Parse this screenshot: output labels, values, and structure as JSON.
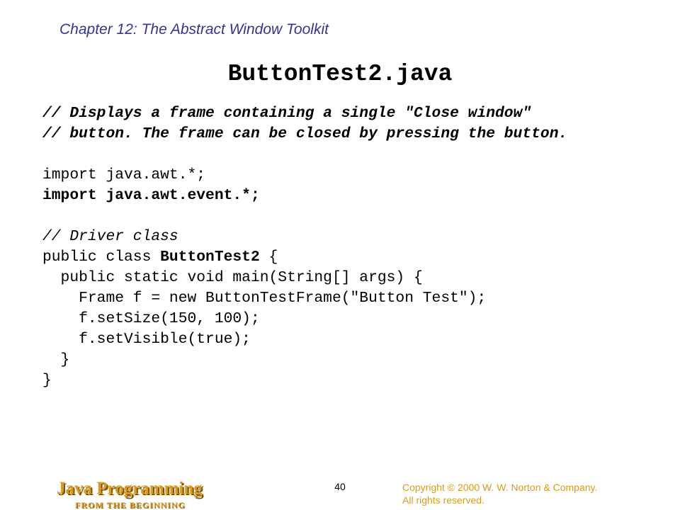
{
  "header": {
    "chapter": "Chapter 12: The Abstract Window Toolkit"
  },
  "slide": {
    "title": "ButtonTest2.java"
  },
  "code": {
    "lines": [
      "// Displays a frame containing a single \"Close window\"",
      "// button. The frame can be closed by pressing the button.",
      "",
      "import java.awt.*;",
      "import java.awt.event.*;",
      "",
      "// Driver class",
      "public class ",
      "ButtonTest2",
      " {",
      "  public static void main(String[] args) {",
      "    Frame f = new ButtonTestFrame(\"Button Test\");",
      "    f.setSize(150, 100);",
      "    f.setVisible(true);",
      "  }",
      "}"
    ]
  },
  "footer": {
    "logo_title": "Java Programming",
    "logo_subtitle": "FROM THE BEGINNING",
    "page_number": "40",
    "copyright_line1": "Copyright © 2000 W. W. Norton & Company.",
    "copyright_line2": "All rights reserved."
  },
  "colors": {
    "chapter_text": "#333399",
    "brand_gold": "#d99a1f",
    "text": "#000000",
    "background": "#ffffff"
  }
}
